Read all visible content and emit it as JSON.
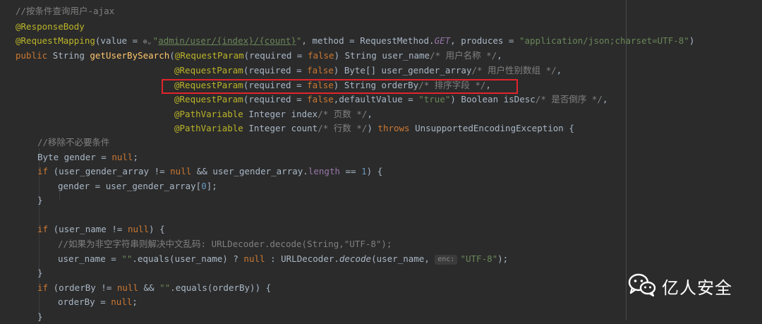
{
  "lines": [
    {
      "id": "l1",
      "tokens": [
        {
          "c": "t-comment",
          "t": "//按条件查询用户-ajax"
        }
      ]
    },
    {
      "id": "l2",
      "tokens": [
        {
          "c": "t-annot",
          "t": "@ResponseBody"
        }
      ]
    },
    {
      "id": "l3",
      "tokens": [
        {
          "c": "t-annot",
          "t": "@RequestMapping"
        },
        {
          "c": "",
          "t": "(value = "
        },
        {
          "c": "hint-globe",
          "t": "⊕⌄"
        },
        {
          "c": "t-str",
          "t": "\""
        },
        {
          "c": "t-link",
          "t": "admin/user/{index}/{count}"
        },
        {
          "c": "t-str",
          "t": "\""
        },
        {
          "c": "",
          "t": ", method = RequestMethod."
        },
        {
          "c": "t-field t-italic",
          "t": "GET"
        },
        {
          "c": "",
          "t": ", produces = "
        },
        {
          "c": "t-str",
          "t": "\"application/json;charset=UTF-8\""
        },
        {
          "c": "",
          "t": ")"
        }
      ]
    },
    {
      "id": "l4",
      "tokens": [
        {
          "c": "t-kw",
          "t": "public "
        },
        {
          "c": "",
          "t": "String "
        },
        {
          "c": "t-method",
          "t": "getUserBySearch"
        },
        {
          "c": "",
          "t": "("
        },
        {
          "c": "t-annot",
          "t": "@RequestParam"
        },
        {
          "c": "",
          "t": "(required = "
        },
        {
          "c": "t-kw",
          "t": "false"
        },
        {
          "c": "",
          "t": ") String user_name"
        },
        {
          "c": "t-comment",
          "t": "/* 用户名称 */"
        },
        {
          "c": "",
          "t": ","
        }
      ]
    },
    {
      "id": "l5",
      "tokens": [
        {
          "c": "t-annot",
          "t": "@RequestParam"
        },
        {
          "c": "",
          "t": "(required = "
        },
        {
          "c": "t-kw",
          "t": "false"
        },
        {
          "c": "",
          "t": ") Byte[] user_gender_array"
        },
        {
          "c": "t-comment",
          "t": "/* 用户性别数组 */"
        },
        {
          "c": "",
          "t": ","
        }
      ]
    },
    {
      "id": "l6",
      "tokens": [
        {
          "c": "t-annot",
          "t": "@RequestParam"
        },
        {
          "c": "",
          "t": "(required = "
        },
        {
          "c": "t-kw",
          "t": "false"
        },
        {
          "c": "",
          "t": ") String orderBy"
        },
        {
          "c": "t-comment",
          "t": "/* 排序字段 */"
        },
        {
          "c": "",
          "t": ","
        }
      ]
    },
    {
      "id": "l7",
      "tokens": [
        {
          "c": "t-annot",
          "t": "@RequestParam"
        },
        {
          "c": "",
          "t": "(required = "
        },
        {
          "c": "t-kw",
          "t": "false"
        },
        {
          "c": "",
          "t": ",defaultValue = "
        },
        {
          "c": "t-str",
          "t": "\"true\""
        },
        {
          "c": "",
          "t": ") Boolean isDesc"
        },
        {
          "c": "t-comment",
          "t": "/* 是否倒序 */"
        },
        {
          "c": "",
          "t": ","
        }
      ]
    },
    {
      "id": "l8",
      "tokens": [
        {
          "c": "t-annot",
          "t": "@PathVariable "
        },
        {
          "c": "",
          "t": "Integer index"
        },
        {
          "c": "t-comment",
          "t": "/* 页数 */"
        },
        {
          "c": "",
          "t": ","
        }
      ]
    },
    {
      "id": "l9",
      "tokens": [
        {
          "c": "t-annot",
          "t": "@PathVariable "
        },
        {
          "c": "",
          "t": "Integer count"
        },
        {
          "c": "t-comment",
          "t": "/* 行数 */"
        },
        {
          "c": "",
          "t": ") "
        },
        {
          "c": "t-kw",
          "t": "throws "
        },
        {
          "c": "",
          "t": "UnsupportedEncodingException {"
        }
      ]
    },
    {
      "id": "l10",
      "tokens": [
        {
          "c": "t-comment",
          "t": "//移除不必要条件"
        }
      ]
    },
    {
      "id": "l11",
      "tokens": [
        {
          "c": "",
          "t": "Byte gender = "
        },
        {
          "c": "t-kw",
          "t": "null"
        },
        {
          "c": "",
          "t": ";"
        }
      ]
    },
    {
      "id": "l12",
      "tokens": [
        {
          "c": "t-kw",
          "t": "if "
        },
        {
          "c": "",
          "t": "(user_gender_array != "
        },
        {
          "c": "t-kw",
          "t": "null "
        },
        {
          "c": "",
          "t": "&& user_gender_array."
        },
        {
          "c": "t-field",
          "t": "length "
        },
        {
          "c": "",
          "t": "== "
        },
        {
          "c": "t-num",
          "t": "1"
        },
        {
          "c": "",
          "t": ") {"
        }
      ]
    },
    {
      "id": "l13",
      "tokens": [
        {
          "c": "",
          "t": "gender = user_gender_array["
        },
        {
          "c": "t-num",
          "t": "0"
        },
        {
          "c": "",
          "t": "];"
        }
      ]
    },
    {
      "id": "l14",
      "tokens": [
        {
          "c": "",
          "t": "}"
        }
      ]
    },
    {
      "id": "l15",
      "tokens": []
    },
    {
      "id": "l16",
      "tokens": [
        {
          "c": "t-kw",
          "t": "if "
        },
        {
          "c": "",
          "t": "(user_name != "
        },
        {
          "c": "t-kw",
          "t": "null"
        },
        {
          "c": "",
          "t": ") {"
        }
      ]
    },
    {
      "id": "l17",
      "tokens": [
        {
          "c": "t-comment",
          "t": "//如果为非空字符串则解决中文乱码: URLDecoder.decode(String,\"UTF-8\");"
        }
      ]
    },
    {
      "id": "l18",
      "tokens": [
        {
          "c": "",
          "t": "user_name = "
        },
        {
          "c": "t-str",
          "t": "\"\""
        },
        {
          "c": "",
          "t": ".equals(user_name) ? "
        },
        {
          "c": "t-kw",
          "t": "null "
        },
        {
          "c": "",
          "t": ": URLDecoder."
        },
        {
          "c": "t-italic",
          "t": "decode"
        },
        {
          "c": "",
          "t": "(user_name, "
        },
        {
          "c": "hint",
          "t": "enc:"
        },
        {
          "c": "t-str",
          "t": "\"UTF-8\""
        },
        {
          "c": "",
          "t": ");"
        }
      ]
    },
    {
      "id": "l19",
      "tokens": [
        {
          "c": "",
          "t": "}"
        }
      ]
    },
    {
      "id": "l20",
      "tokens": [
        {
          "c": "t-kw",
          "t": "if "
        },
        {
          "c": "",
          "t": "(orderBy != "
        },
        {
          "c": "t-kw",
          "t": "null "
        },
        {
          "c": "",
          "t": "&& "
        },
        {
          "c": "t-str",
          "t": "\"\""
        },
        {
          "c": "",
          "t": ".equals(orderBy)) {"
        }
      ]
    },
    {
      "id": "l21",
      "tokens": [
        {
          "c": "",
          "t": "orderBy = "
        },
        {
          "c": "t-kw",
          "t": "null"
        },
        {
          "c": "",
          "t": ";"
        }
      ]
    },
    {
      "id": "l22",
      "tokens": [
        {
          "c": "",
          "t": "}"
        }
      ]
    }
  ],
  "watermark": {
    "text": "亿人安全",
    "icon": "wechat-icon"
  }
}
